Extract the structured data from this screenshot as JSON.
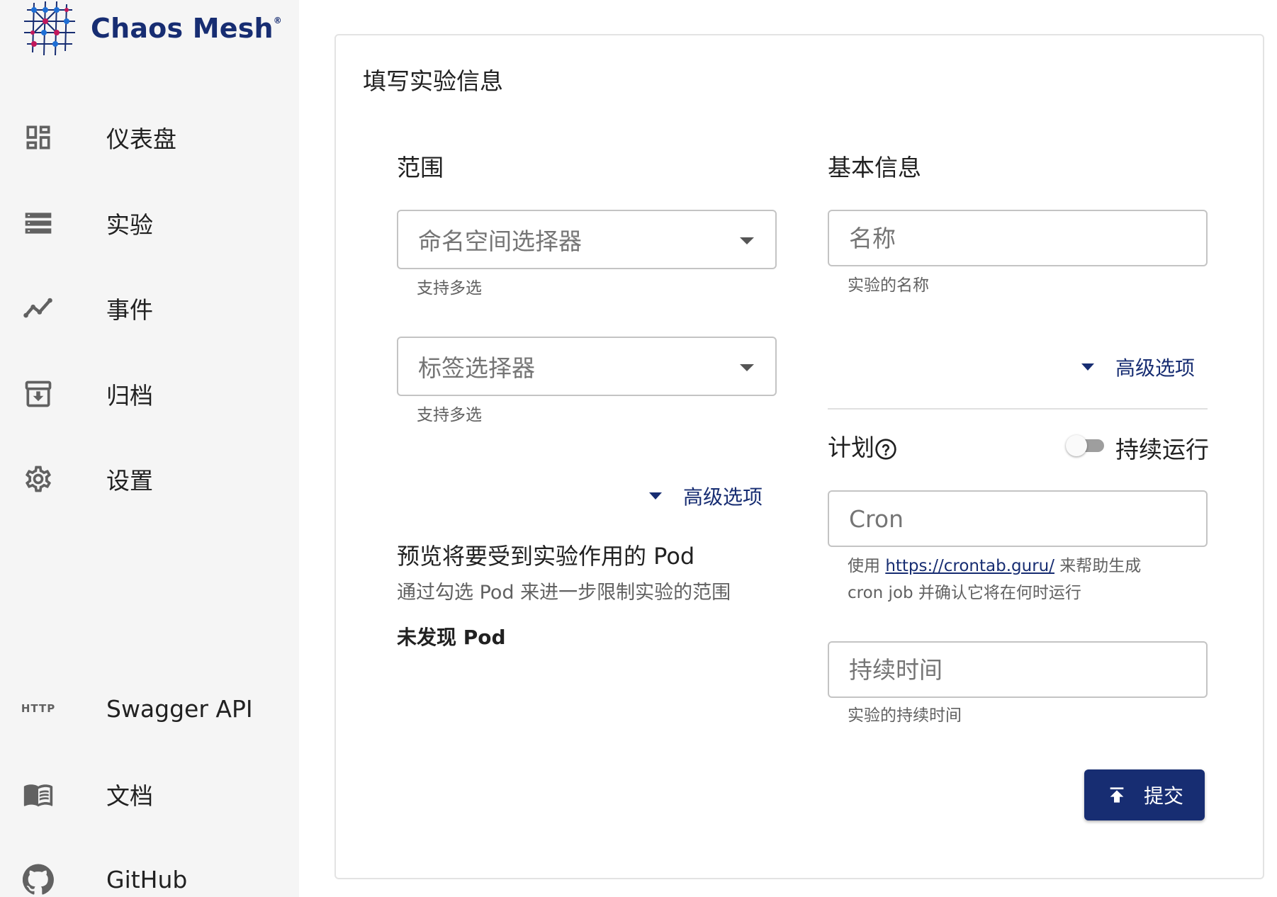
{
  "brand": {
    "name": "Chaos Mesh",
    "reg": "®"
  },
  "nav": [
    {
      "label": "仪表盘",
      "icon": "dashboard-icon"
    },
    {
      "label": "实验",
      "icon": "list-icon"
    },
    {
      "label": "事件",
      "icon": "timeline-icon"
    },
    {
      "label": "归档",
      "icon": "archive-icon"
    },
    {
      "label": "设置",
      "icon": "settings-icon"
    }
  ],
  "nav_bottom": [
    {
      "label": "Swagger API",
      "icon": "http-icon",
      "icon_text": "HTTP"
    },
    {
      "label": "文档",
      "icon": "book-icon"
    },
    {
      "label": "GitHub",
      "icon": "github-icon"
    }
  ],
  "form": {
    "title": "填写实验信息",
    "scope": {
      "title": "范围",
      "namespace_placeholder": "命名空间选择器",
      "namespace_helper": "支持多选",
      "label_placeholder": "标签选择器",
      "label_helper": "支持多选",
      "advanced": "高级选项",
      "preview_title": "预览将要受到实验作用的 Pod",
      "preview_sub": "通过勾选 Pod 来进一步限制实验的范围",
      "no_pod": "未发现 Pod"
    },
    "basic": {
      "title": "基本信息",
      "name_placeholder": "名称",
      "name_helper": "实验的名称",
      "advanced": "高级选项",
      "schedule_label": "计划",
      "continuous_label": "持续运行",
      "cron_placeholder": "Cron",
      "cron_helper_prefix": "使用",
      "cron_helper_link": "https://crontab.guru/",
      "cron_helper_suffix": "来帮助生成",
      "cron_helper_line2": "cron job 并确认它将在何时运行",
      "duration_placeholder": "持续时间",
      "duration_helper": "实验的持续时间"
    },
    "submit": "提交"
  },
  "colors": {
    "primary": "#172d72",
    "sidebar_bg": "#f5f5f5",
    "border": "#c4c4c4"
  }
}
